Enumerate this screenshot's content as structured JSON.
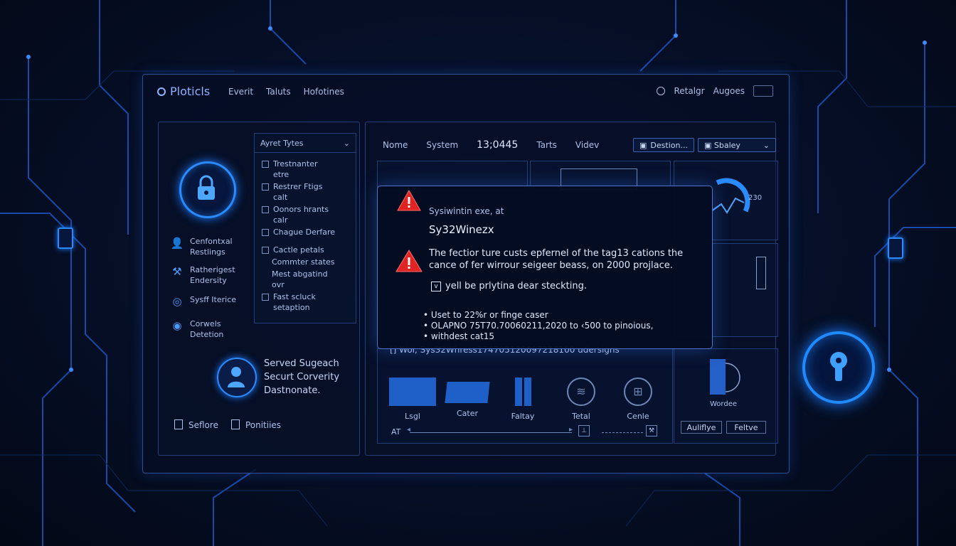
{
  "app": {
    "title": "Ploticls"
  },
  "topnav": [
    "Everit",
    "Taluts",
    "Hofotines"
  ],
  "topright": {
    "label_1": "Retalgr",
    "label_2": "Augoes"
  },
  "left_panel": {
    "features": [
      {
        "icon": "user-icon",
        "line1": "Cenfontxal",
        "line2": "Restlings"
      },
      {
        "icon": "tools-icon",
        "line1": "Ratherigest",
        "line2": "Endersity"
      },
      {
        "icon": "fingerprint-icon",
        "line1": "Sysff Iterice",
        "line2": ""
      },
      {
        "icon": "shield-eye-icon",
        "line1": "Corwels",
        "line2": "Detetion"
      }
    ],
    "dropdown": {
      "label": "Ayret Tytes",
      "items": [
        {
          "line1": "Trestnanter",
          "line2": "etre",
          "checkbox": true
        },
        {
          "line1": "Restrer Ftigs",
          "line2": "calt",
          "checkbox": true
        },
        {
          "line1": "Oonors hrants",
          "line2": "calr",
          "checkbox": true
        },
        {
          "line1": "Chague Derfare",
          "line2": "",
          "checkbox": true
        },
        {
          "line1": "Cactle petals",
          "line2": "",
          "checkbox": true
        },
        {
          "line1": "Commter states",
          "line2": "",
          "checkbox": false
        },
        {
          "line1": "Mest abgatind",
          "line2": "ovr",
          "checkbox": false
        },
        {
          "line1": "Fast scluck",
          "line2": "setaption",
          "checkbox": true
        }
      ]
    },
    "served": {
      "line1": "Served Sugeach",
      "line2": "Securt Corverity",
      "line3": "Dastnonate."
    },
    "footer": {
      "item1": "Seflore",
      "item2": "Ponitiies"
    }
  },
  "main": {
    "tabs": [
      "Nome",
      "System",
      "13;0445",
      "Tarts",
      "Videv"
    ],
    "btn1": "Destion...",
    "btn2": "Sbaley",
    "gauge_label": "230",
    "status_line": "[] Wol, Sys32Whress174705120097218100 udersigns",
    "tools": [
      "Lsgl",
      "Cater",
      "Faltay",
      "Tetal",
      "Cenle"
    ],
    "bottom_prefix": "AT",
    "right_card": {
      "label": "Wordee",
      "btn1": "Auliflye",
      "btn2": "Feltve"
    }
  },
  "dialog": {
    "header": "Sysiwintin exe, at",
    "title": "Sy32Winezx",
    "message": "The fectior ture custs epfernel of the tag13 cations the cance of fer wirrour seigeer beass, on 2000 projlace.",
    "check_label": "yell be prlytina dear steckting.",
    "bullets": [
      "Uset to 22%r or finge caser",
      "OLAPNO 75T70.70060211,2020 to ‹500 to pinoious,",
      "withdest cat15"
    ]
  },
  "colors": {
    "accent": "#2a8bff",
    "warning": "#e02424",
    "background": "#061029"
  }
}
